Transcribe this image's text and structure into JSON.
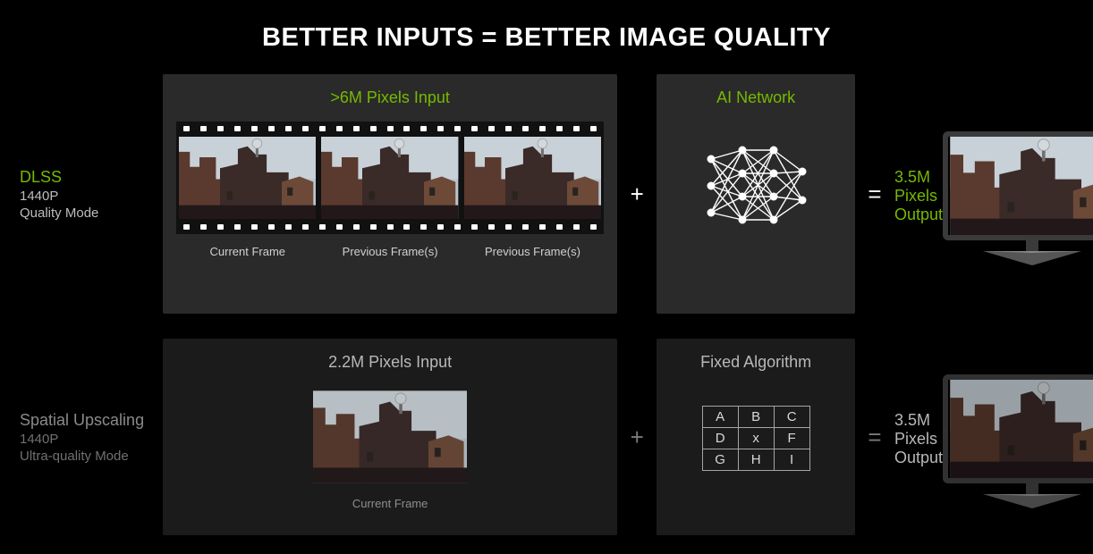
{
  "title": "BETTER INPUTS = BETTER IMAGE QUALITY",
  "row1": {
    "label": {
      "name": "DLSS",
      "res": "1440P",
      "mode": "Quality Mode"
    },
    "input": {
      "header": ">6M Pixels Input",
      "frame_labels": [
        "Current Frame",
        "Previous Frame(s)",
        "Previous Frame(s)"
      ]
    },
    "network": {
      "header": "AI Network"
    },
    "output": {
      "header": "3.5M Pixels Output"
    },
    "op_plus": "+",
    "op_equals": "="
  },
  "row2": {
    "label": {
      "name": "Spatial Upscaling",
      "res": "1440P",
      "mode": "Ultra-quality Mode"
    },
    "input": {
      "header": "2.2M Pixels Input",
      "frame_label": "Current Frame"
    },
    "network": {
      "header": "Fixed Algorithm",
      "kernel": [
        [
          "A",
          "B",
          "C"
        ],
        [
          "D",
          "x",
          "F"
        ],
        [
          "G",
          "H",
          "I"
        ]
      ]
    },
    "output": {
      "header": "3.5M Pixels Output"
    },
    "op_plus": "+",
    "op_equals": "="
  }
}
